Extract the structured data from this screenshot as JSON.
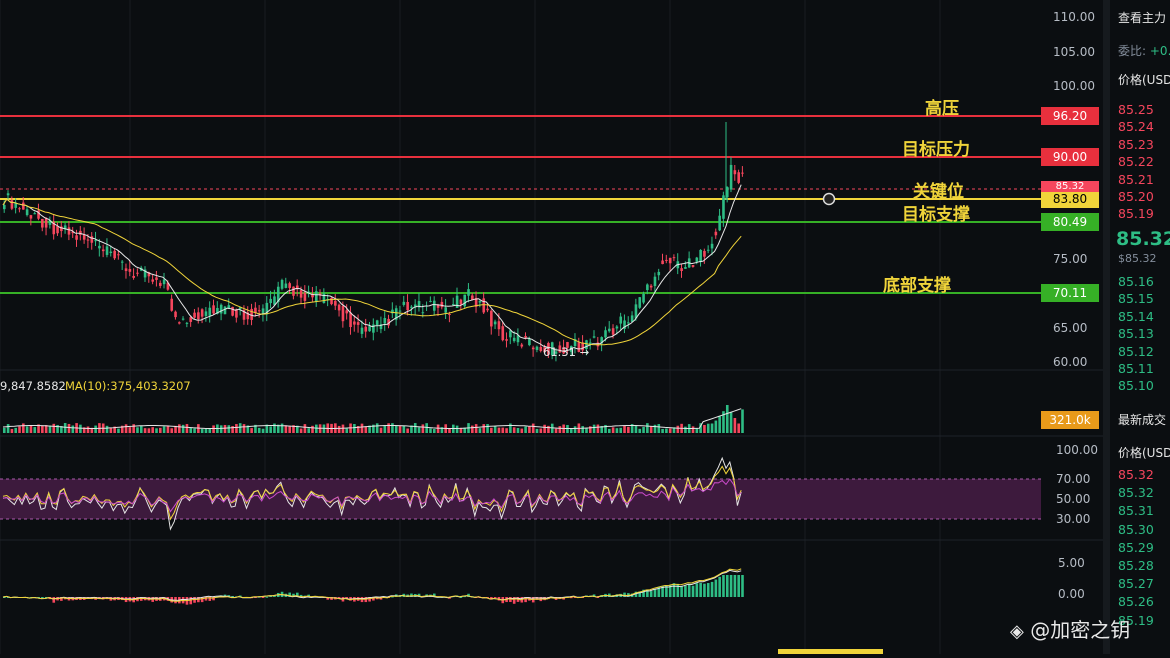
{
  "price_axis": [
    "110.00",
    "105.00",
    "100.00",
    "95.00",
    "90.00",
    "85.00",
    "80.00",
    "75.00",
    "70.00",
    "65.00",
    "60.00"
  ],
  "levels": [
    {
      "label": "高压",
      "value": "96.20",
      "color": "#e8303d",
      "name": "level-high-pressure"
    },
    {
      "label": "目标压力",
      "value": "90.00",
      "color": "#e8303d",
      "name": "level-target-pressure"
    },
    {
      "label": "关键位",
      "value": "83.80",
      "color": "#f0d43a",
      "name": "level-key"
    },
    {
      "label": "目标支撑",
      "value": "80.49",
      "color": "#36b026",
      "name": "level-target-support"
    },
    {
      "label": "底部支撑",
      "value": "70.11",
      "color": "#36b026",
      "name": "level-bottom-support"
    }
  ],
  "current_price_badge": "85.32",
  "low_marker": "61.31 →",
  "volume": {
    "legend_value": "9,847.8582",
    "ma10": "MA(10):375,403.3207",
    "badge": "321.0k"
  },
  "rsi_axis": [
    "100.00",
    "70.00",
    "50.00",
    "30.00"
  ],
  "macd_axis": [
    "5.00",
    "0.00"
  ],
  "sidebar": {
    "top_title": "查看主力",
    "ratio_label": "委比:",
    "ratio_value": "+0.",
    "price_header": "价格(USD",
    "asks": [
      "85.25",
      "85.24",
      "85.23",
      "85.22",
      "85.21",
      "85.20",
      "85.19"
    ],
    "last_price": "85.32",
    "last_price_sub": "$85.32",
    "bids": [
      "85.16",
      "85.15",
      "85.14",
      "85.13",
      "85.12",
      "85.11",
      "85.10"
    ],
    "trades_title": "最新成交",
    "trades_header": "价格(USD",
    "trades": [
      {
        "p": "85.32",
        "c": "#f6465d"
      },
      {
        "p": "85.32",
        "c": "#2ebd85"
      },
      {
        "p": "85.31",
        "c": "#2ebd85"
      },
      {
        "p": "85.30",
        "c": "#2ebd85"
      },
      {
        "p": "85.29",
        "c": "#2ebd85"
      },
      {
        "p": "85.28",
        "c": "#2ebd85"
      },
      {
        "p": "85.27",
        "c": "#2ebd85"
      },
      {
        "p": "85.26",
        "c": "#2ebd85"
      },
      {
        "p": "85.19",
        "c": "#2ebd85"
      }
    ]
  },
  "watermark": "@加密之钥",
  "colors": {
    "up": "#2ebd85",
    "down": "#f6465d",
    "ma_white": "#e6e6e6",
    "ma_yellow": "#f0d43a",
    "rsi_band": "#3d1a3d"
  }
}
